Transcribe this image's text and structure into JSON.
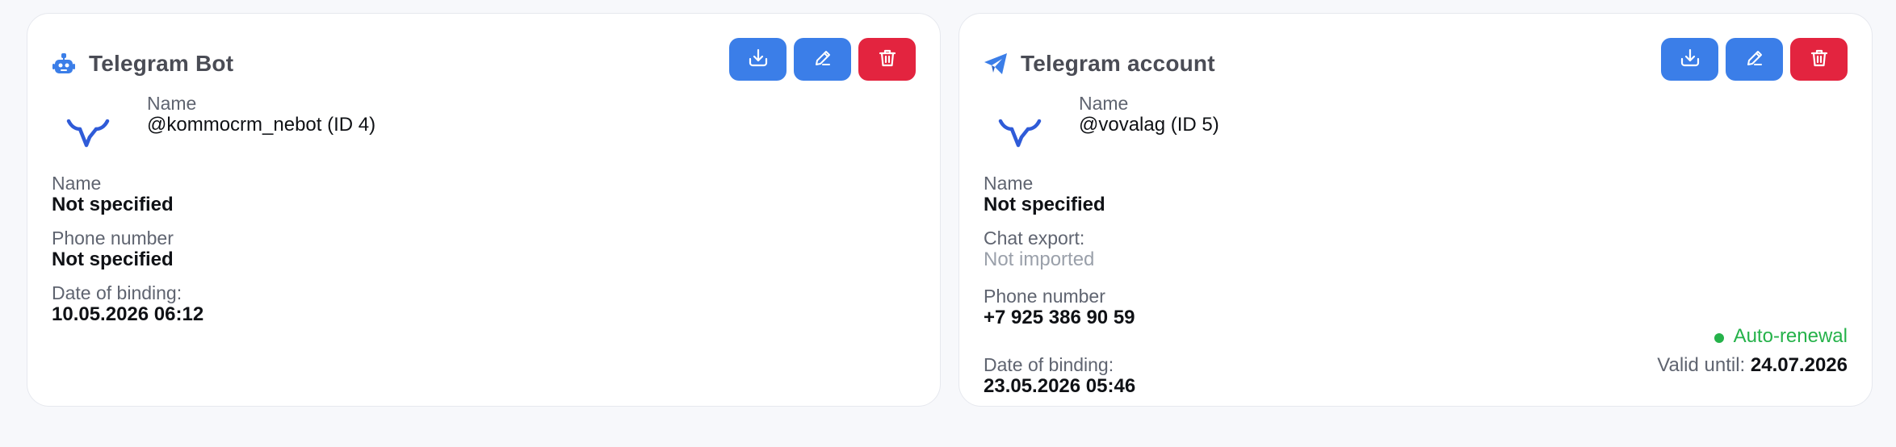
{
  "colors": {
    "primary": "#3b7ee8",
    "danger": "#e3243f",
    "success": "#25b24a",
    "title": "#4a4c55",
    "label": "#5f6470",
    "muted": "#9aa0aa"
  },
  "cards": [
    {
      "title": "Telegram Bot",
      "title_icon": "robot-icon",
      "actions": [
        {
          "icon": "download-icon"
        },
        {
          "icon": "pencil-icon"
        },
        {
          "icon": "trash-icon"
        }
      ],
      "profile": {
        "logo": "bull-logo",
        "label": "Name",
        "value": "@kommocrm_nebot (ID 4)"
      },
      "fields": [
        {
          "label": "Name",
          "value": "Not specified"
        },
        {
          "label": "Phone number",
          "value": "Not specified"
        },
        {
          "label": "Date of binding:",
          "value": "10.05.2026 06:12"
        }
      ]
    },
    {
      "title": "Telegram account",
      "title_icon": "paper-plane-icon",
      "actions": [
        {
          "icon": "download-icon"
        },
        {
          "icon": "pencil-icon"
        },
        {
          "icon": "trash-icon"
        }
      ],
      "profile": {
        "logo": "bull-logo",
        "label": "Name",
        "value": "@vovalag (ID 5)"
      },
      "fields": [
        {
          "label": "Name",
          "value": "Not specified"
        },
        {
          "label": "Chat export:",
          "value": "Not imported"
        },
        {
          "label": "Phone number",
          "value": "+7 925 386 90 59"
        },
        {
          "label": "Date of binding:",
          "value": "23.05.2026 05:46"
        }
      ],
      "status": {
        "renewal": "Auto-renewal",
        "valid_label": "Valid until:",
        "valid_date": "24.07.2026"
      }
    }
  ]
}
